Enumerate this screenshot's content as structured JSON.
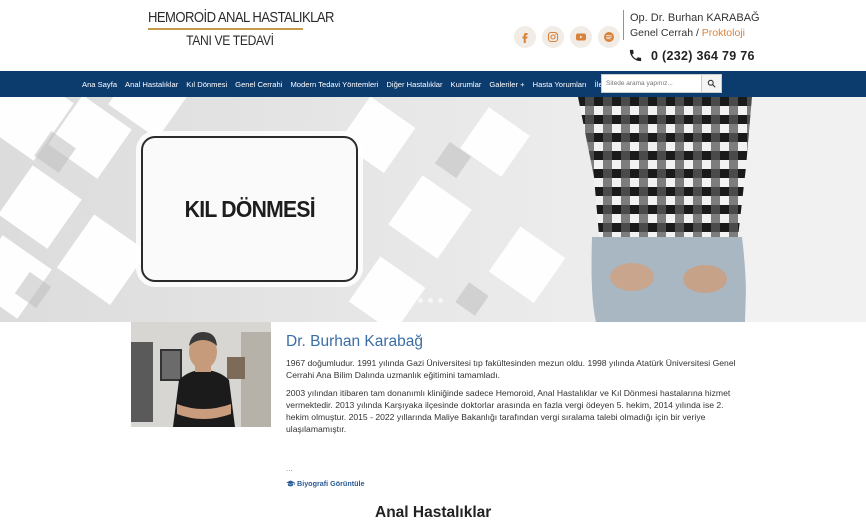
{
  "logo": {
    "line1": "HEMOROİD ANAL HASTALIKLAR",
    "line2": "TANI VE TEDAVİ"
  },
  "socials": [
    {
      "icon": "facebook-icon"
    },
    {
      "icon": "instagram-icon"
    },
    {
      "icon": "youtube-icon"
    },
    {
      "icon": "spotify-icon"
    }
  ],
  "contact": {
    "name": "Op. Dr. Burhan KARABAĞ",
    "title": "Genel Cerrah",
    "separator": "/",
    "specialty": "Proktoloji",
    "phone": "0 (232) 364 79 76"
  },
  "nav": {
    "items": [
      "Ana Sayfa",
      "Anal Hastalıklar",
      "Kıl Dönmesi",
      "Genel Cerrahi",
      "Modern Tedavi Yöntemleri",
      "Diğer Hastalıklar",
      "Kurumlar",
      "Galeriler +",
      "Hasta Yorumları",
      "İletişim"
    ],
    "search_placeholder": "Sitede arama yapınız..."
  },
  "hero": {
    "card_title": "KIL DÖNMESİ",
    "slides": 4,
    "active_slide": 1
  },
  "bio": {
    "name": "Dr. Burhan Karabağ",
    "p1": "1967 doğumludur. 1991 yılında Gazi Üniversitesi tıp fakültesinden mezun oldu. 1998 yılında Atatürk Üniversitesi Genel Cerrahi Ana Bilim Dalında uzmanlık eğitimini tamamladı.",
    "p2": "2003 yılından itibaren tam donanımlı kliniğinde sadece Hemoroid, Anal Hastalıklar ve Kıl Dönmesi hastalarına hizmet vermektedir. 2013 yılında Karşıyaka ilçesinde doktorlar arasında en fazla vergi ödeyen 5. hekim, 2014 yılında ise 2. hekim olmuştur. 2015 - 2022 yıllarında Maliye Bakanlığı tarafından vergi sıralama talebi olmadığı için bir veriye ulaşılamamıştır.",
    "ellipsis": "...",
    "more_link": "Biyografi Görüntüle"
  },
  "section": {
    "title": "Anal Hastalıklar"
  },
  "colors": {
    "nav": "#0c3b6e",
    "accent": "#d9823a",
    "link": "#3a6ea5"
  }
}
